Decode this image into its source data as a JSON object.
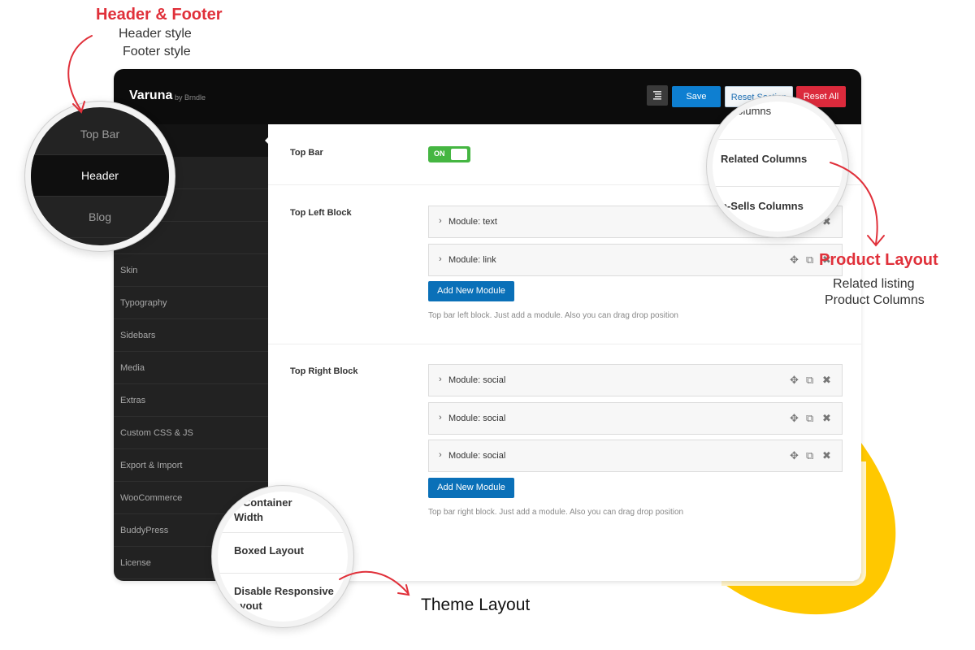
{
  "annotations": {
    "header_footer": {
      "title": "Header & Footer",
      "lines": [
        "Header style",
        "Footer style"
      ]
    },
    "product_layout": {
      "title": "Product Layout",
      "lines": [
        "Related listing",
        "Product Columns"
      ]
    },
    "theme_layout": {
      "title": "Theme Layout"
    }
  },
  "app": {
    "name": "Varuna",
    "by": "by Brndle"
  },
  "toolbar": {
    "save": "Save",
    "reset_section": "Reset Section",
    "reset_all": "Reset All"
  },
  "sidebar": {
    "items": [
      "",
      "",
      "",
      "ooter",
      "Skin",
      "Typography",
      "Sidebars",
      "Media",
      "Extras",
      "Custom CSS & JS",
      "Export & Import",
      "WooCommerce",
      "BuddyPress",
      "License"
    ]
  },
  "content": {
    "top_bar": {
      "label": "Top Bar",
      "toggle": "ON"
    },
    "top_left_block": {
      "label": "Top Left Block",
      "modules": [
        "Module: text",
        "Module: link"
      ],
      "add_button": "Add New Module",
      "help": "Top bar left block. Just add a module. Also you can drag drop position"
    },
    "top_right_block": {
      "label": "Top Right Block",
      "modules": [
        "Module: social",
        "Module: social",
        "Module: social"
      ],
      "add_button": "Add New Module",
      "help": "Top bar right block. Just add a module. Also you can drag drop position"
    }
  },
  "zoom_left": {
    "items": [
      "Top Bar",
      "Header",
      "Blog"
    ]
  },
  "zoom_right": {
    "items": [
      "p Columns",
      "Related Columns",
      "p-Sells Columns"
    ]
  },
  "zoom_bottom": {
    "items": [
      "e Container",
      "Width",
      "Boxed Layout",
      "Disable Responsive",
      "ayout"
    ]
  },
  "colors": {
    "accent_red": "#e0303a",
    "save_blue": "#0e7fd1",
    "toggle_green": "#45b642",
    "yellow": "#ffc800"
  }
}
